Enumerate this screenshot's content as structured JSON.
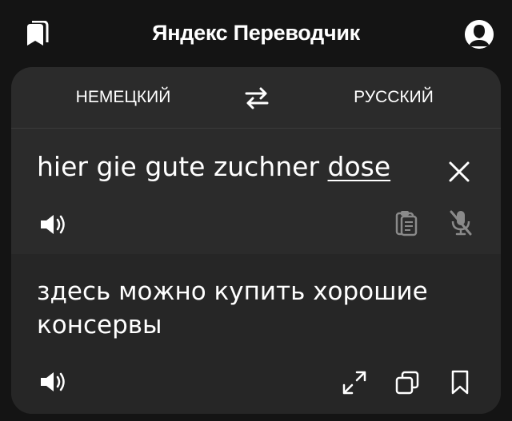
{
  "header": {
    "title": "Яндекс Переводчик",
    "bookmarks_icon": "bookmarks-icon",
    "avatar_icon": "user-avatar-icon"
  },
  "languages": {
    "source": "НЕМЕЦКИЙ",
    "target": "РУССКИЙ",
    "swap_icon": "swap-arrows-icon"
  },
  "input": {
    "text_before": "hier gie gute zuchner ",
    "text_underlined": "dose",
    "clear_icon": "close-icon",
    "speak_icon": "speaker-icon",
    "paste_icon": "clipboard-icon",
    "mic_icon": "mic-off-icon"
  },
  "output": {
    "translation": "здесь можно купить хорошие консервы",
    "speak_icon": "speaker-icon",
    "fullscreen_icon": "expand-icon",
    "copy_icon": "copy-icon",
    "bookmark_icon": "bookmark-icon"
  },
  "colors": {
    "background": "#141414",
    "card": "#2b2b2b",
    "output_panel": "#262626",
    "text": "#ffffff",
    "muted_icon": "#8a8a8a"
  }
}
